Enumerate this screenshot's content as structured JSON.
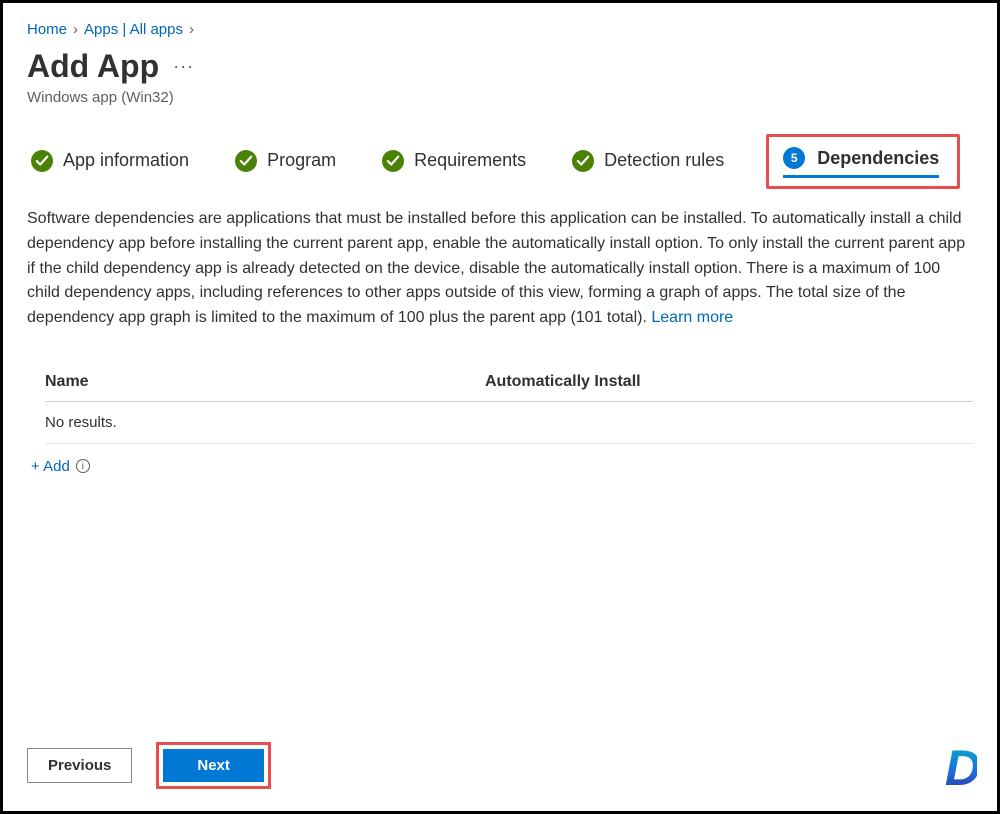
{
  "breadcrumb": {
    "home": "Home",
    "apps": "Apps | All apps"
  },
  "page": {
    "title": "Add App",
    "subtitle": "Windows app (Win32)"
  },
  "tabs": {
    "t1": "App information",
    "t2": "Program",
    "t3": "Requirements",
    "t4": "Detection rules",
    "active_num": "5",
    "active_label": "Dependencies"
  },
  "description": {
    "text": "Software dependencies are applications that must be installed before this application can be installed. To automatically install a child dependency app before installing the current parent app, enable the automatically install option. To only install the current parent app if the child dependency app is already detected on the device, disable the automatically install option. There is a maximum of 100 child dependency apps, including references to other apps outside of this view, forming a graph of apps. The total size of the dependency app graph is limited to the maximum of 100 plus the parent app (101 total). ",
    "learn_more": "Learn more"
  },
  "table": {
    "col_name": "Name",
    "col_auto": "Automatically Install",
    "no_results": "No results."
  },
  "add": {
    "label": "+ Add"
  },
  "footer": {
    "previous": "Previous",
    "next": "Next"
  },
  "logo": "D"
}
